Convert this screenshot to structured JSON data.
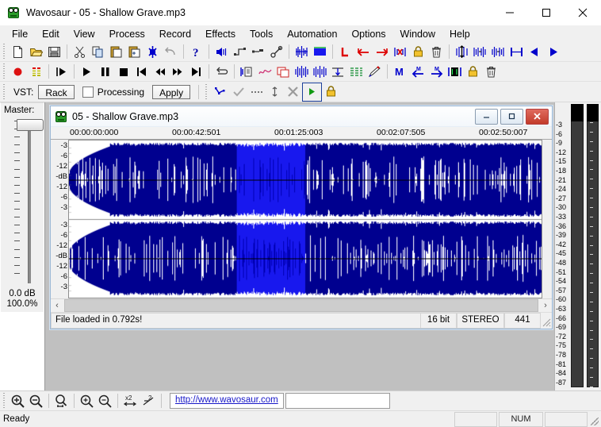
{
  "window": {
    "title": "Wavosaur - 05 - Shallow Grave.mp3",
    "icon": "frog-icon",
    "minimize_label": "–",
    "maximize_label": "□",
    "close_label": "✕"
  },
  "menubar": {
    "items": [
      {
        "label": "File"
      },
      {
        "label": "Edit"
      },
      {
        "label": "View"
      },
      {
        "label": "Process"
      },
      {
        "label": "Record"
      },
      {
        "label": "Effects"
      },
      {
        "label": "Tools"
      },
      {
        "label": "Automation"
      },
      {
        "label": "Options"
      },
      {
        "label": "Window"
      },
      {
        "label": "Help"
      }
    ]
  },
  "toolbar_main": {
    "groups": [
      {
        "buttons": [
          {
            "icon": "new-file-icon",
            "title": "New"
          },
          {
            "icon": "open-folder-icon",
            "title": "Open"
          },
          {
            "icon": "save-disk-icon",
            "title": "Save"
          }
        ]
      },
      {
        "buttons": [
          {
            "icon": "cut-scissors-icon",
            "title": "Cut"
          },
          {
            "icon": "copy-icon",
            "title": "Copy"
          },
          {
            "icon": "paste-icon",
            "title": "Paste"
          },
          {
            "icon": "paste-new-icon",
            "title": "Paste New"
          },
          {
            "icon": "mix-paste-icon",
            "title": "Mix Paste"
          },
          {
            "icon": "undo-icon",
            "title": "Undo"
          }
        ]
      },
      {
        "buttons": [
          {
            "icon": "help-question-icon",
            "title": "Help"
          }
        ]
      },
      {
        "buttons": [
          {
            "icon": "volume-speaker-icon",
            "title": "Volume"
          },
          {
            "icon": "normalize-icon",
            "title": "Normalize"
          },
          {
            "icon": "fade-icon",
            "title": "Fade"
          },
          {
            "icon": "tools-wrench-icon",
            "title": "Tools"
          }
        ]
      },
      {
        "buttons": [
          {
            "icon": "waveform-sel-icon",
            "title": "Waveform"
          },
          {
            "icon": "waveform-blue-icon",
            "title": "Waveform Blue"
          }
        ]
      },
      {
        "buttons": [
          {
            "icon": "marker-l-icon",
            "title": "Left Marker"
          },
          {
            "icon": "arrow-left-red-icon",
            "title": "Previous"
          },
          {
            "icon": "arrow-right-red-icon",
            "title": "Next"
          },
          {
            "icon": "marker-delete-icon",
            "title": "Delete Marker"
          },
          {
            "icon": "lock-yellow-icon",
            "title": "Lock"
          },
          {
            "icon": "trash-icon",
            "title": "Delete"
          }
        ]
      },
      {
        "buttons": [
          {
            "icon": "zoom-sel-icon",
            "title": "Zoom Selection"
          },
          {
            "icon": "sel-start-icon",
            "title": "Selection Start"
          },
          {
            "icon": "sel-end-icon",
            "title": "Selection End"
          },
          {
            "icon": "sel-all-icon",
            "title": "Select All"
          },
          {
            "icon": "play-left-icon",
            "title": "Play Backward"
          },
          {
            "icon": "play-right-icon",
            "title": "Play Forward"
          }
        ]
      }
    ]
  },
  "toolbar_transport": {
    "groups": [
      {
        "buttons": [
          {
            "icon": "record-icon",
            "title": "Record"
          },
          {
            "icon": "levels-icon",
            "title": "Levels"
          }
        ]
      },
      {
        "buttons": [
          {
            "icon": "play-sel-icon",
            "title": "Play Selection"
          }
        ]
      },
      {
        "buttons": [
          {
            "icon": "play-icon",
            "title": "Play"
          },
          {
            "icon": "pause-icon",
            "title": "Pause"
          },
          {
            "icon": "stop-icon",
            "title": "Stop"
          },
          {
            "icon": "prev-icon",
            "title": "Go to Start"
          },
          {
            "icon": "rewind-icon",
            "title": "Rewind"
          },
          {
            "icon": "forward-icon",
            "title": "Forward"
          },
          {
            "icon": "next-icon",
            "title": "Go to End"
          }
        ]
      },
      {
        "buttons": [
          {
            "icon": "loop-icon",
            "title": "Loop"
          }
        ]
      },
      {
        "buttons": [
          {
            "icon": "batch-icon",
            "title": "Batch Processor"
          },
          {
            "icon": "analysis-icon",
            "title": "Analysis"
          },
          {
            "icon": "copy-window-icon",
            "title": "Duplicate"
          },
          {
            "icon": "spectrum-icon",
            "title": "Spectrum"
          },
          {
            "icon": "spectrum2-icon",
            "title": "Spectrum 2"
          },
          {
            "icon": "downsample-icon",
            "title": "Resample"
          },
          {
            "icon": "bitdepth-icon",
            "title": "Bit Depth"
          },
          {
            "icon": "pencil-icon",
            "title": "Draw"
          }
        ]
      },
      {
        "buttons": [
          {
            "icon": "marker-m-icon",
            "title": "Marker"
          },
          {
            "icon": "marker-prev-icon",
            "title": "Previous Marker"
          },
          {
            "icon": "marker-next-icon",
            "title": "Next Marker"
          },
          {
            "icon": "marker-region-icon",
            "title": "Region"
          },
          {
            "icon": "lock2-icon",
            "title": "Lock"
          },
          {
            "icon": "trash2-icon",
            "title": "Delete"
          }
        ]
      }
    ]
  },
  "vst_bar": {
    "label": "VST:",
    "rack_button": "Rack",
    "processing_label": "Processing",
    "processing_checked": false,
    "apply_button": "Apply",
    "buttons": [
      {
        "icon": "envelope-icon",
        "title": "Envelope"
      },
      {
        "icon": "check-icon",
        "title": "Validate"
      },
      {
        "icon": "dots-icon",
        "title": "More"
      },
      {
        "icon": "vertical-arrows-icon",
        "title": "Vertical"
      },
      {
        "icon": "close-x-icon",
        "title": "Close"
      },
      {
        "icon": "play-green-icon",
        "title": "Play"
      },
      {
        "icon": "lock-yellow-icon",
        "title": "Lock"
      }
    ]
  },
  "master": {
    "title": "Master:",
    "db_value": "0.0 dB",
    "pct_value": "100.0%"
  },
  "child_window": {
    "title": "05 - Shallow Grave.mp3",
    "icon": "frog-icon",
    "minimize_label": "–",
    "restore_label": "□",
    "close_label": "✕",
    "ruler_labels": [
      "00:00:00:000",
      "00:00:42:501",
      "00:01:25:003",
      "00:02:07:505",
      "00:02:50:007"
    ],
    "db_scale_top": [
      "-3",
      "-6",
      "-12",
      "-dB",
      "-12",
      "-6",
      "-3"
    ],
    "db_scale_bottom": [
      "-3",
      "-6",
      "-12",
      "-dB",
      "-12",
      "-6",
      "-3"
    ],
    "status": {
      "message": "File loaded in 0.792s!",
      "bit_depth": "16 bit",
      "channels": "STEREO",
      "samplerate": "441"
    },
    "scroll_left": "‹",
    "scroll_right": "›"
  },
  "vu_meter": {
    "scale": [
      "-3",
      "-6",
      "-9",
      "-12",
      "-15",
      "-18",
      "-21",
      "-24",
      "-27",
      "-30",
      "-33",
      "-36",
      "-39",
      "-42",
      "-45",
      "-48",
      "-51",
      "-54",
      "-57",
      "-60",
      "-63",
      "-66",
      "-69",
      "-72",
      "-75",
      "-78",
      "-81",
      "-84",
      "-87"
    ]
  },
  "bottom_bar": {
    "buttons": [
      {
        "icon": "zoom-in-icon",
        "title": "Zoom In"
      },
      {
        "icon": "zoom-out-icon",
        "title": "Zoom Out"
      },
      {
        "icon": "zoom-selection-icon",
        "title": "Zoom Selection"
      },
      {
        "icon": "zoom-vert-in-icon",
        "title": "Zoom Vertical In"
      },
      {
        "icon": "zoom-vert-out-icon",
        "title": "Zoom Vertical Out"
      },
      {
        "icon": "zoom-x2-icon",
        "title": "Zoom x2"
      },
      {
        "icon": "zoom-div2-icon",
        "title": "Zoom /2"
      }
    ],
    "url": "http://www.wavosaur.com"
  },
  "statusbar": {
    "message": "Ready",
    "num_indicator": "NUM"
  },
  "colors": {
    "waveform_fill": "#00008f",
    "waveform_selection": "#1818ee",
    "background": "#c0c0c0",
    "chrome": "#f0f0f0",
    "link": "#1717c8",
    "close_red": "#c23b2a",
    "record_red": "#dd1111",
    "accent_blue": "#0000cc"
  },
  "waveform": {
    "selection_start_pct": 35.5,
    "selection_end_pct": 50.0,
    "silence_end_pct": 8.5
  }
}
